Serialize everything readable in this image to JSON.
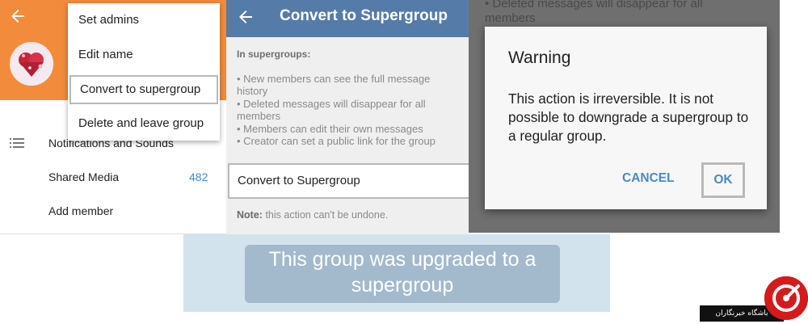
{
  "panel1": {
    "menu": {
      "items": [
        {
          "label": "Set admins"
        },
        {
          "label": "Edit name"
        },
        {
          "label": "Convert to supergroup"
        },
        {
          "label": "Delete and leave group"
        }
      ]
    },
    "rows": {
      "notifications": "Notifications and Sounds",
      "shared_media": "Shared Media",
      "shared_media_count": "482",
      "add_member": "Add member"
    },
    "header_color": "#f28b3c"
  },
  "panel2": {
    "title": "Convert to Supergroup",
    "header_color": "#557ba9",
    "info_heading": "In supergroups:",
    "info_lines": [
      "• New members can see the full message history",
      "• Deleted messages will disappear for all members",
      "• Members can edit their own messages",
      "• Creator can set a public link for the group"
    ],
    "convert_button": "Convert to Supergroup",
    "note_label": "Note:",
    "note_text": "this action can't be undone."
  },
  "panel3": {
    "background_text": "• Deleted messages will disappear for all members",
    "dialog": {
      "title": "Warning",
      "body": "This action is irreversible. It is not possible to downgrade a supergroup to a regular group.",
      "cancel_label": "CANCEL",
      "ok_label": "OK"
    }
  },
  "banner": {
    "message": "This group was upgraded to a supergroup"
  },
  "logo": {
    "text": "باشگاه خبرنگاران"
  },
  "icons": {
    "back": "back-arrow-icon",
    "list": "list-icon"
  }
}
